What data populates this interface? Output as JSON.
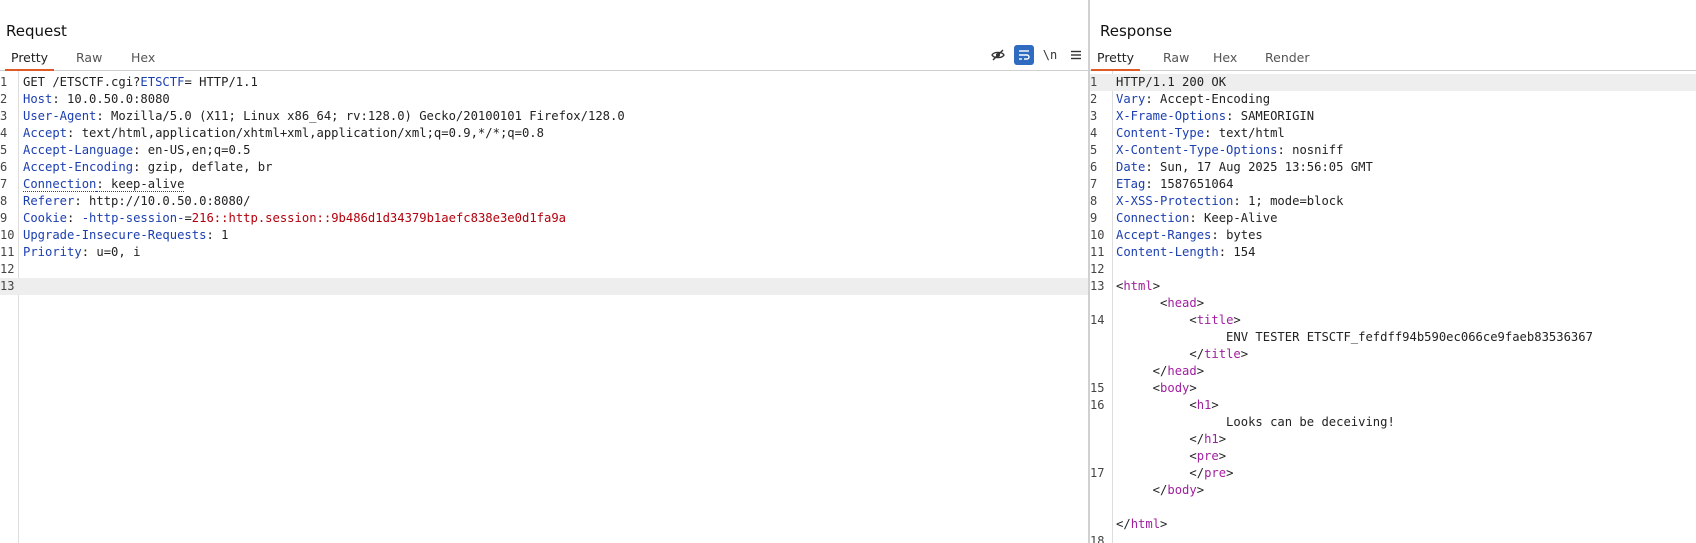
{
  "request": {
    "title": "Request",
    "tabs": [
      "Pretty",
      "Raw",
      "Hex"
    ],
    "toolbar": {
      "hide_icon": "eye-slash-icon",
      "wrap_icon": "word-wrap-icon",
      "newline_label": "\\n",
      "menu_icon": "menu-icon"
    },
    "lines": [
      {
        "n": "1",
        "parts": [
          {
            "t": "GET /ETSCTF.cgi?",
            "c": ""
          },
          {
            "t": "ETSCTF",
            "c": "hn"
          },
          {
            "t": "= HTTP/1.1",
            "c": ""
          }
        ]
      },
      {
        "n": "2",
        "parts": [
          {
            "t": "Host",
            "c": "hn"
          },
          {
            "t": ": 10.0.50.0:8080",
            "c": ""
          }
        ]
      },
      {
        "n": "3",
        "parts": [
          {
            "t": "User-Agent",
            "c": "hn"
          },
          {
            "t": ": Mozilla/5.0 (X11; Linux x86_64; rv:128.0) Gecko/20100101 Firefox/128.0",
            "c": ""
          }
        ]
      },
      {
        "n": "4",
        "parts": [
          {
            "t": "Accept",
            "c": "hn"
          },
          {
            "t": ": text/html,application/xhtml+xml,application/xml;q=0.9,*/*;q=0.8",
            "c": ""
          }
        ]
      },
      {
        "n": "5",
        "parts": [
          {
            "t": "Accept-Language",
            "c": "hn"
          },
          {
            "t": ": en-US,en;q=0.5",
            "c": ""
          }
        ]
      },
      {
        "n": "6",
        "parts": [
          {
            "t": "Accept-Encoding",
            "c": "hn"
          },
          {
            "t": ": gzip, deflate, br",
            "c": ""
          }
        ]
      },
      {
        "n": "7",
        "parts": [
          {
            "t": "Connection",
            "c": "hn dashed"
          },
          {
            "t": ": keep-alive",
            "c": "dashed"
          }
        ]
      },
      {
        "n": "8",
        "parts": [
          {
            "t": "Referer",
            "c": "hn"
          },
          {
            "t": ": http://10.0.50.0:8080/",
            "c": ""
          }
        ]
      },
      {
        "n": "9",
        "parts": [
          {
            "t": "Cookie",
            "c": "hn"
          },
          {
            "t": ": ",
            "c": ""
          },
          {
            "t": "-http-session-",
            "c": "hn"
          },
          {
            "t": "=",
            "c": ""
          },
          {
            "t": "216::http.session::9b486d1d34379b1aefc838e3e0d1fa9a",
            "c": "pv"
          }
        ]
      },
      {
        "n": "10",
        "parts": [
          {
            "t": "Upgrade-Insecure-Requests",
            "c": "hn"
          },
          {
            "t": ": 1",
            "c": ""
          }
        ]
      },
      {
        "n": "11",
        "parts": [
          {
            "t": "Priority",
            "c": "hn"
          },
          {
            "t": ": u=0, i",
            "c": ""
          }
        ]
      },
      {
        "n": "12",
        "parts": []
      },
      {
        "n": "13",
        "parts": [],
        "highlight": true
      }
    ]
  },
  "response": {
    "title": "Response",
    "tabs": [
      "Pretty",
      "Raw",
      "Hex",
      "Render"
    ],
    "lines": [
      {
        "n": "1",
        "parts": [
          {
            "t": "HTTP/1.1 200 OK",
            "c": ""
          }
        ],
        "highlight": true
      },
      {
        "n": "2",
        "parts": [
          {
            "t": "Vary",
            "c": "hn"
          },
          {
            "t": ": Accept-Encoding",
            "c": ""
          }
        ]
      },
      {
        "n": "3",
        "parts": [
          {
            "t": "X-Frame-Options",
            "c": "hn"
          },
          {
            "t": ": SAMEORIGIN",
            "c": ""
          }
        ]
      },
      {
        "n": "4",
        "parts": [
          {
            "t": "Content-Type",
            "c": "hn"
          },
          {
            "t": ": text/html",
            "c": ""
          }
        ]
      },
      {
        "n": "5",
        "parts": [
          {
            "t": "X-Content-Type-Options",
            "c": "hn"
          },
          {
            "t": ": nosniff",
            "c": ""
          }
        ]
      },
      {
        "n": "6",
        "parts": [
          {
            "t": "Date",
            "c": "hn"
          },
          {
            "t": ": Sun, 17 Aug 2025 13:56:05 GMT",
            "c": ""
          }
        ]
      },
      {
        "n": "7",
        "parts": [
          {
            "t": "ETag",
            "c": "hn"
          },
          {
            "t": ": 1587651064",
            "c": ""
          }
        ]
      },
      {
        "n": "8",
        "parts": [
          {
            "t": "X-XSS-Protection",
            "c": "hn"
          },
          {
            "t": ": 1; mode=block",
            "c": ""
          }
        ]
      },
      {
        "n": "9",
        "parts": [
          {
            "t": "Connection",
            "c": "hn"
          },
          {
            "t": ": Keep-Alive",
            "c": ""
          }
        ]
      },
      {
        "n": "10",
        "parts": [
          {
            "t": "Accept-Ranges",
            "c": "hn"
          },
          {
            "t": ": bytes",
            "c": ""
          }
        ]
      },
      {
        "n": "11",
        "parts": [
          {
            "t": "Content-Length",
            "c": "hn"
          },
          {
            "t": ": 154",
            "c": ""
          }
        ]
      },
      {
        "n": "12",
        "parts": []
      },
      {
        "n": "13",
        "parts": [
          {
            "t": "<",
            "c": ""
          },
          {
            "t": "html",
            "c": "tg"
          },
          {
            "t": ">",
            "c": ""
          }
        ]
      },
      {
        "n": "",
        "parts": [
          {
            "t": "      <",
            "c": ""
          },
          {
            "t": "head",
            "c": "tg"
          },
          {
            "t": ">",
            "c": ""
          }
        ]
      },
      {
        "n": "14",
        "parts": [
          {
            "t": "          <",
            "c": ""
          },
          {
            "t": "title",
            "c": "tg"
          },
          {
            "t": ">",
            "c": ""
          }
        ]
      },
      {
        "n": "",
        "parts": [
          {
            "t": "               ENV TESTER ETSCTF_fefdff94b590ec066ce9faeb83536367",
            "c": ""
          }
        ]
      },
      {
        "n": "",
        "parts": [
          {
            "t": "          </",
            "c": ""
          },
          {
            "t": "title",
            "c": "tg"
          },
          {
            "t": ">",
            "c": ""
          }
        ]
      },
      {
        "n": "",
        "parts": [
          {
            "t": "     </",
            "c": ""
          },
          {
            "t": "head",
            "c": "tg"
          },
          {
            "t": ">",
            "c": ""
          }
        ]
      },
      {
        "n": "15",
        "parts": [
          {
            "t": "     <",
            "c": ""
          },
          {
            "t": "body",
            "c": "tg"
          },
          {
            "t": ">",
            "c": ""
          }
        ]
      },
      {
        "n": "16",
        "parts": [
          {
            "t": "          <",
            "c": ""
          },
          {
            "t": "h1",
            "c": "tg"
          },
          {
            "t": ">",
            "c": ""
          }
        ]
      },
      {
        "n": "",
        "parts": [
          {
            "t": "               Looks can be deceiving!",
            "c": ""
          }
        ]
      },
      {
        "n": "",
        "parts": [
          {
            "t": "          </",
            "c": ""
          },
          {
            "t": "h1",
            "c": "tg"
          },
          {
            "t": ">",
            "c": ""
          }
        ]
      },
      {
        "n": "",
        "parts": [
          {
            "t": "          <",
            "c": ""
          },
          {
            "t": "pre",
            "c": "tg"
          },
          {
            "t": ">",
            "c": ""
          }
        ]
      },
      {
        "n": "17",
        "parts": [
          {
            "t": "          </",
            "c": ""
          },
          {
            "t": "pre",
            "c": "tg"
          },
          {
            "t": ">",
            "c": ""
          }
        ]
      },
      {
        "n": "",
        "parts": [
          {
            "t": "     </",
            "c": ""
          },
          {
            "t": "body",
            "c": "tg"
          },
          {
            "t": ">",
            "c": ""
          }
        ]
      },
      {
        "n": "",
        "parts": []
      },
      {
        "n": "",
        "parts": [
          {
            "t": "</",
            "c": ""
          },
          {
            "t": "html",
            "c": "tg"
          },
          {
            "t": ">",
            "c": ""
          }
        ]
      },
      {
        "n": "18",
        "parts": []
      }
    ]
  }
}
